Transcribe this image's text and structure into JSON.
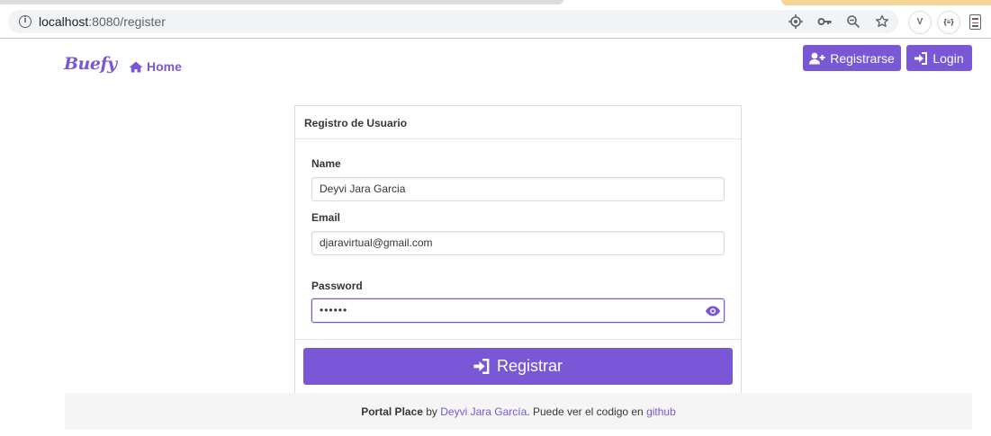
{
  "browser": {
    "url_host": "localhost",
    "url_path": ":8080/register",
    "extensions": [
      "V",
      "{≡}"
    ]
  },
  "nav": {
    "brand": "Buefy",
    "home_label": "Home",
    "register_label": "Registrarse",
    "login_label": "Login"
  },
  "form": {
    "title": "Registro de Usuario",
    "name_label": "Name",
    "name_value": "Deyvi Jara Garcia",
    "email_label": "Email",
    "email_value": "djaravirtual@gmail.com",
    "password_label": "Password",
    "password_value": "••••••",
    "submit_label": "Registrar"
  },
  "footer": {
    "app_name": "Portal Place",
    "by_text": " by ",
    "author": "Deyvi Jara García",
    "middle_text": ". Puede ver el codigo en ",
    "link_text": "github"
  },
  "colors": {
    "primary": "#7957d5",
    "footer_bg": "#f5f5f5"
  },
  "icons": {
    "register": "user-plus-icon",
    "login": "sign-in-icon",
    "home": "home-icon",
    "password_toggle": "eye-icon"
  }
}
